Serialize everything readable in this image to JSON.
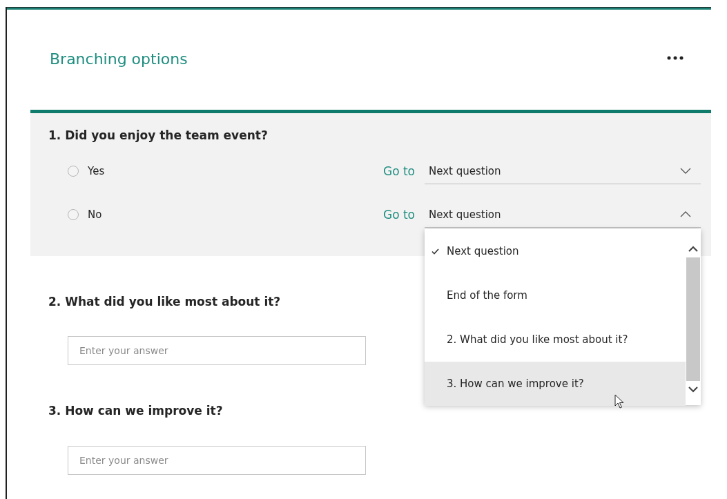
{
  "title": "Branching options",
  "questions": [
    {
      "title": "1. Did you enjoy the team event?",
      "kind": "choice",
      "options": [
        {
          "label": "Yes",
          "selected": false,
          "goto_label": "Go to",
          "goto_value": "Next question",
          "expanded": false
        },
        {
          "label": "No",
          "selected": false,
          "goto_label": "Go to",
          "goto_value": "Next question",
          "expanded": true,
          "menu": [
            {
              "label": "Next question",
              "selected": true,
              "hovered": false
            },
            {
              "label": "End of the form",
              "selected": false,
              "hovered": false
            },
            {
              "label": "2. What did you like most about it?",
              "selected": false,
              "hovered": false
            },
            {
              "label": "3. How can we improve it?",
              "selected": false,
              "hovered": true
            }
          ]
        }
      ]
    },
    {
      "title": "2. What did you like most about it?",
      "kind": "text",
      "placeholder": "Enter your answer"
    },
    {
      "title": "3. How can we improve it?",
      "kind": "text",
      "placeholder": "Enter your answer"
    }
  ]
}
